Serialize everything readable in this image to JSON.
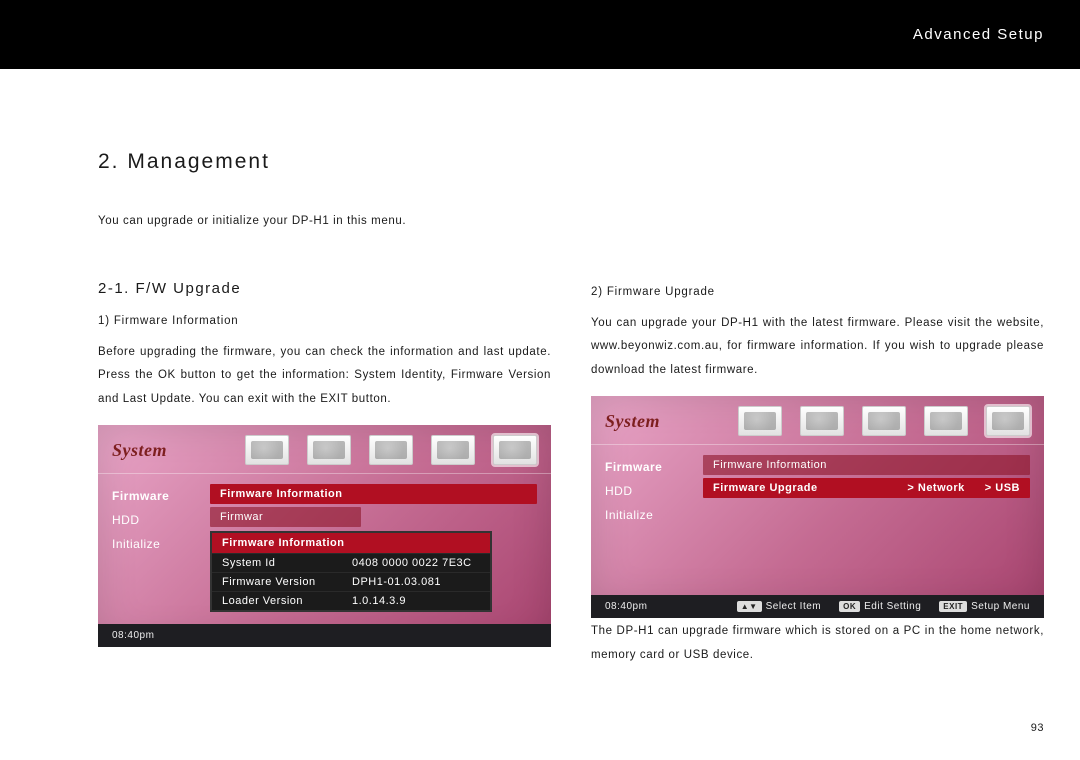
{
  "header": {
    "title": "Advanced Setup"
  },
  "section": {
    "title": "2. Management",
    "intro": "You can upgrade or initialize your DP-H1 in this menu."
  },
  "left": {
    "subsection": "2-1. F/W Upgrade",
    "item_title": "1) Firmware Information",
    "body": "Before upgrading the firmware, you can check the information and last update. Press the OK button to get the information: System Identity, Firmware Version and Last Update. You can exit with the EXIT button."
  },
  "right": {
    "item_title": "2) Firmware Upgrade",
    "body": "You can upgrade your DP-H1 with the latest firmware. Please visit the website, www.beyonwiz.com.au, for firmware information. If you wish to upgrade please download the latest firmware.",
    "after": "The DP-H1 can upgrade firmware which is stored on a PC in the home network, memory card or USB device."
  },
  "shot1": {
    "system_label": "System",
    "side": [
      "Firmware",
      "HDD",
      "Initialize"
    ],
    "rows": [
      "Firmware Information",
      "Firmware Upgrade"
    ],
    "popup_title": "Firmware Information",
    "popup_rows": [
      {
        "k": "System Id",
        "v": "0408 0000 0022 7E3C"
      },
      {
        "k": "Firmware Version",
        "v": "DPH1-01.03.081"
      },
      {
        "k": "Loader Version",
        "v": "1.0.14.3.9"
      }
    ],
    "time": "08:40pm"
  },
  "shot2": {
    "system_label": "System",
    "side": [
      "Firmware",
      "HDD",
      "Initialize"
    ],
    "rows": [
      {
        "label": "Firmware Information"
      },
      {
        "label": "Firmware Upgrade",
        "opts": [
          "Network",
          "USB"
        ]
      }
    ],
    "time": "08:40pm",
    "hints": [
      {
        "badge": "▲▼",
        "label": "Select Item"
      },
      {
        "badge": "OK",
        "label": "Edit Setting"
      },
      {
        "badge": "EXIT",
        "label": "Setup Menu"
      }
    ]
  },
  "page_number": "93"
}
